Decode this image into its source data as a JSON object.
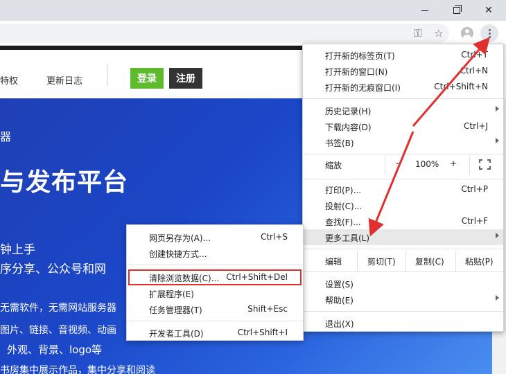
{
  "window": {
    "controls": {
      "minimize_icon": "minimize-icon",
      "maximize_icon": "maximize-icon",
      "close_glyph": "✕"
    }
  },
  "toolbar": {
    "key_glyph": "⚿",
    "star_glyph": "☆"
  },
  "site": {
    "nav": [
      "特权",
      "更新日志"
    ],
    "login": "登录",
    "register": "注册",
    "hero": {
      "small": "器",
      "title": "与发布平台",
      "line1": "钟上手",
      "line2": "序分享、公众号和网",
      "line3": "无需软件，无需网站服务器",
      "line4": "图片、链接、音视频、动画",
      "line5": "外观、背景、logo等",
      "line6": "书房集中展示作品，集中分享和阅读"
    }
  },
  "menu": {
    "items1": [
      {
        "label": "打开新的标签页(T)",
        "shortcut": "Ctrl+T"
      },
      {
        "label": "打开新的窗口(N)",
        "shortcut": "Ctrl+N"
      },
      {
        "label": "打开新的无痕窗口(I)",
        "shortcut": "Ctrl+Shift+N"
      }
    ],
    "items2": [
      {
        "label": "历史记录(H)",
        "shortcut": ""
      },
      {
        "label": "下载内容(D)",
        "shortcut": "Ctrl+J"
      },
      {
        "label": "书签(B)",
        "shortcut": ""
      }
    ],
    "zoom": {
      "label": "缩放",
      "minus": "-",
      "value": "100%",
      "plus": "+"
    },
    "items3": [
      {
        "label": "打印(P)...",
        "shortcut": "Ctrl+P"
      },
      {
        "label": "投射(C)...",
        "shortcut": ""
      },
      {
        "label": "查找(F)...",
        "shortcut": "Ctrl+F"
      },
      {
        "label": "更多工具(L)",
        "shortcut": ""
      }
    ],
    "edit": {
      "label": "编辑",
      "cut": "剪切(T)",
      "copy": "复制(C)",
      "paste": "粘贴(P)"
    },
    "items4": [
      {
        "label": "设置(S)"
      },
      {
        "label": "帮助(E)"
      }
    ],
    "exit": "退出(X)"
  },
  "submenu": {
    "items": [
      {
        "label": "网页另存为(A)...",
        "shortcut": "Ctrl+S"
      },
      {
        "label": "创建快捷方式...",
        "shortcut": ""
      },
      {
        "label": "清除浏览数据(C)...",
        "shortcut": "Ctrl+Shift+Del"
      },
      {
        "label": "扩展程序(E)",
        "shortcut": ""
      },
      {
        "label": "任务管理器(T)",
        "shortcut": "Shift+Esc"
      },
      {
        "label": "开发者工具(D)",
        "shortcut": "Ctrl+Shift+I"
      }
    ]
  },
  "colors": {
    "annotation": "#e0302f",
    "login": "#5dbb2d",
    "hero": "#1f3fb5"
  }
}
